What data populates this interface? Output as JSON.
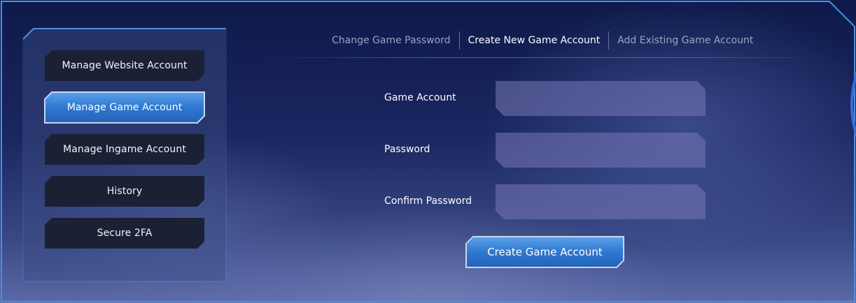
{
  "sidebar": {
    "items": [
      {
        "label": "Manage Website Account",
        "active": false
      },
      {
        "label": "Manage Game Account",
        "active": true
      },
      {
        "label": "Manage Ingame Account",
        "active": false
      },
      {
        "label": "History",
        "active": false
      },
      {
        "label": "Secure 2FA",
        "active": false
      }
    ]
  },
  "tabs": [
    {
      "label": "Change Game Password",
      "active": false
    },
    {
      "label": "Create New Game Account",
      "active": true
    },
    {
      "label": "Add Existing Game Account",
      "active": false
    }
  ],
  "form": {
    "game_account": {
      "label": "Game Account",
      "value": "",
      "placeholder": ""
    },
    "password": {
      "label": "Password",
      "value": "",
      "placeholder": ""
    },
    "confirm_password": {
      "label": "Confirm Password",
      "value": "",
      "placeholder": ""
    },
    "submit_label": "Create Game Account"
  },
  "colors": {
    "accent": "#2e78d0",
    "frame_border": "#4a8fe0",
    "button_dark": "#1b2035"
  }
}
